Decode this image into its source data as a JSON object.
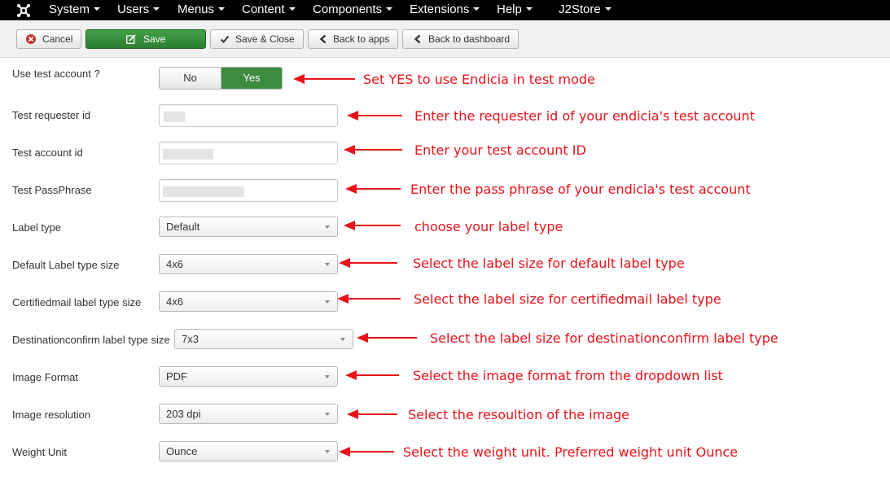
{
  "nav": {
    "items": [
      "System",
      "Users",
      "Menus",
      "Content",
      "Components",
      "Extensions",
      "Help",
      "J2Store"
    ]
  },
  "toolbar": {
    "cancel": "Cancel",
    "save": "Save",
    "save_close": "Save & Close",
    "back_apps": "Back to apps",
    "back_dashboard": "Back to dashboard"
  },
  "form": {
    "use_test_account": {
      "label": "Use test account ?",
      "no": "No",
      "yes": "Yes",
      "selected": "Yes"
    },
    "test_requester_id": {
      "label": "Test requester id"
    },
    "test_account_id": {
      "label": "Test account id"
    },
    "test_passphrase": {
      "label": "Test PassPhrase"
    },
    "label_type": {
      "label": "Label type",
      "value": "Default"
    },
    "default_label_size": {
      "label": "Default Label type size",
      "value": "4x6"
    },
    "certifiedmail_label_size": {
      "label": "Certifiedmail label type size",
      "value": "4x6"
    },
    "destinationconfirm_label_size": {
      "label": "Destinationconfirm label type size",
      "value": "7x3"
    },
    "image_format": {
      "label": "Image Format",
      "value": "PDF"
    },
    "image_resolution": {
      "label": "Image resolution",
      "value": "203 dpi"
    },
    "weight_unit": {
      "label": "Weight Unit",
      "value": "Ounce"
    }
  },
  "annotations": [
    "Set YES to use Endicia in test mode",
    "Enter the requester id of your endicia's test account",
    "Enter your test account ID",
    "Enter the pass phrase of your endicia's test account",
    "choose your label type",
    "Select the label size for default label type",
    "Select the label size for certifiedmail label type",
    "Select the label size for destinationconfirm label type",
    "Select the image format from the dropdown list",
    "Select the resoultion of the image",
    "Select the weight unit. Preferred weight unit Ounce"
  ],
  "colors": {
    "annotation": "#e8121a",
    "save_green": "#3d8b40",
    "topbar": "#000000"
  }
}
